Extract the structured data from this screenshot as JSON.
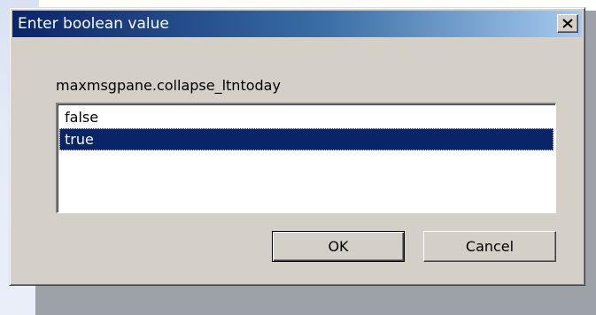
{
  "dialog": {
    "title": "Enter boolean value",
    "close_icon": "close-icon"
  },
  "prompt": {
    "label": "maxmsgpane.collapse_ltntoday"
  },
  "options": {
    "items": [
      "false",
      "true"
    ],
    "selected": "true"
  },
  "buttons": {
    "ok_label": "OK",
    "cancel_label": "Cancel"
  },
  "colors": {
    "title_bar_start": "#0a246a",
    "title_bar_end": "#a6caf0",
    "selection": "#0a246a",
    "dialog_face": "#d4d0c8"
  }
}
